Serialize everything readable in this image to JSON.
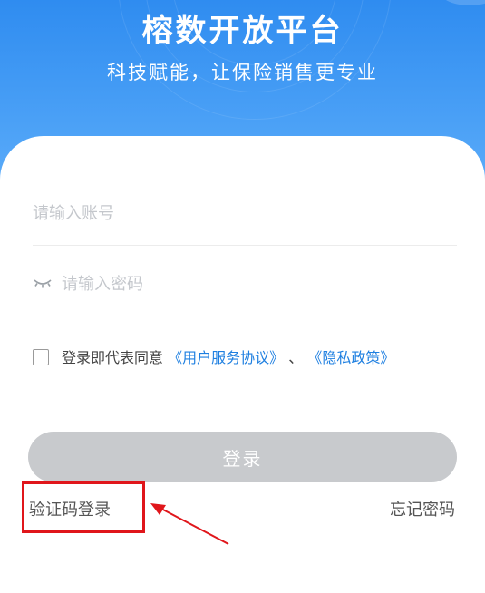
{
  "header": {
    "title": "榕数开放平台",
    "subtitle": "科技赋能，让保险销售更专业"
  },
  "form": {
    "account_placeholder": "请输入账号",
    "password_placeholder": "请输入密码",
    "password_icon": "eye-closed-icon"
  },
  "agreement": {
    "prefix": "登录即代表同意",
    "user_agreement": "《用户服务协议》",
    "separator": "、",
    "privacy_policy": "《隐私政策》",
    "checked": false
  },
  "actions": {
    "login_label": "登录",
    "sms_login_label": "验证码登录",
    "forgot_password_label": "忘记密码"
  },
  "colors": {
    "header_blue": "#3a96f3",
    "link_blue": "#1e7fe0",
    "disabled_button": "#c8cacd",
    "annotation_red": "#e0161b"
  }
}
